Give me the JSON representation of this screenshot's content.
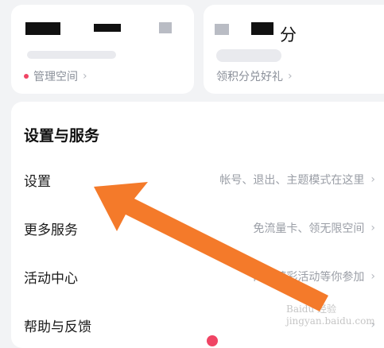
{
  "top_cards": {
    "left": {
      "link_label": "管理空间"
    },
    "right": {
      "points_suffix": "分",
      "link_label": "领积分兑好礼"
    }
  },
  "settings_section": {
    "title": "设置与服务",
    "rows": [
      {
        "label": "设置",
        "hint": "帐号、退出、主题模式在这里"
      },
      {
        "label": "更多服务",
        "hint": "免流量卡、领无限空间"
      },
      {
        "label": "活动中心",
        "hint": "网盘精彩活动等你参加"
      },
      {
        "label": "帮助与反馈",
        "hint": ""
      }
    ]
  },
  "icons": {
    "chevron": "chevron-right-icon",
    "annotation": "arrow-pointer-icon",
    "status_dot": "status-dot-icon"
  },
  "colors": {
    "accent_red": "#f04464",
    "arrow_orange": "#f47a2a"
  },
  "chevron_glyph": "›",
  "watermark_text": "Baidu 经验 jingyan.baidu.com"
}
